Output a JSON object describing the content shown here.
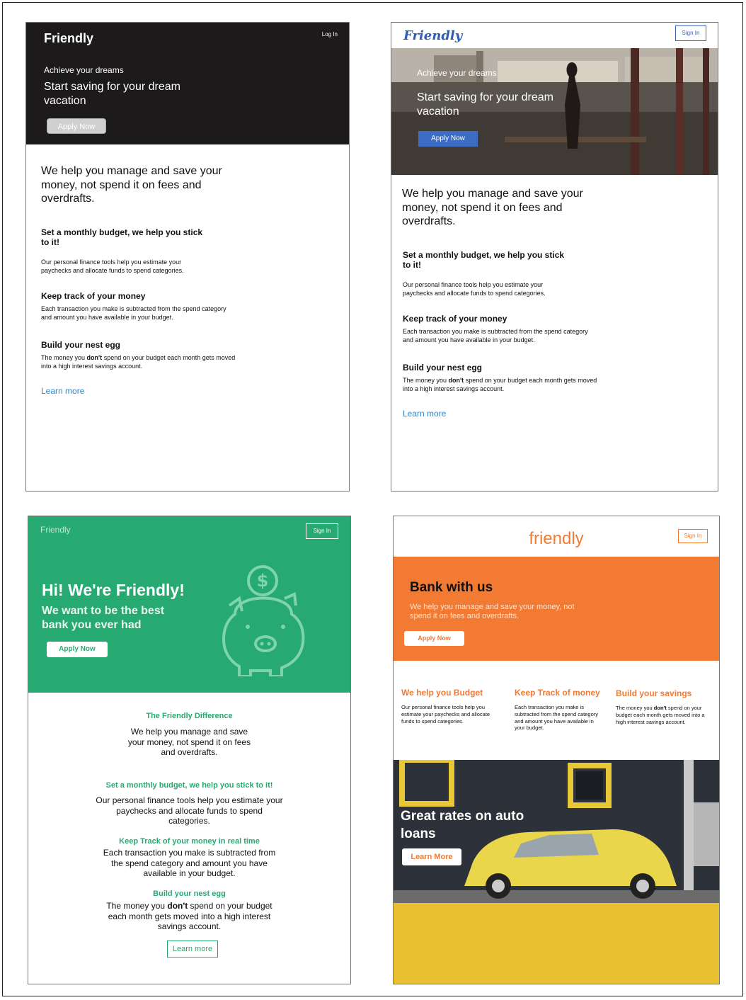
{
  "panel1": {
    "logo": "Friendly",
    "login": "Log In",
    "tagline": "Achieve your dreams",
    "headline": "Start saving for your dream vacation",
    "apply": "Apply Now",
    "intro": "We help you manage and save your money, not spend it on fees and overdrafts.",
    "f1_title": "Set a monthly budget, we help you stick to it!",
    "f1_text": "Our personal finance tools help you estimate your paychecks and allocate funds to spend categories.",
    "f2_title": "Keep track of your money",
    "f2_text": "Each transaction you make is subtracted from the spend category and amount you have available in your budget.",
    "f3_title": "Build your nest egg",
    "f3_pre": "The money you ",
    "f3_bold": "don't",
    "f3_post": " spend on your budget each month gets moved into a high interest savings account.",
    "learn": "Learn more"
  },
  "panel2": {
    "logo": "Friendly",
    "signin": "Sign In",
    "tagline": "Achieve your dreams",
    "headline": "Start saving for your dream vacation",
    "apply": "Apply Now",
    "intro": "We help you manage and save your money, not spend it on fees and overdrafts.",
    "f1_title": "Set a monthly budget, we help you stick to it!",
    "f1_text": "Our personal finance tools help you estimate your paychecks and allocate funds to spend categories.",
    "f2_title": "Keep track of your money",
    "f2_text": "Each transaction you make is subtracted from the spend category and amount you have available in your budget.",
    "f3_title": "Build your nest egg",
    "f3_pre": "The money you ",
    "f3_bold": "don't",
    "f3_post": " spend on your budget each month gets moved into a high interest savings account.",
    "learn": "Learn more"
  },
  "panel3": {
    "logo": "Friendly",
    "signin": "Sign In",
    "headline": "Hi! We're Friendly!",
    "sub": "We want to be the best bank you ever had",
    "apply": "Apply Now",
    "diff_title": "The Friendly Difference",
    "diff_text": "We help you manage and save your money, not spend it on fees and overdrafts.",
    "f1_title": "Set a monthly budget, we help you stick to it!",
    "f1_text": "Our personal finance tools help you estimate your paychecks and allocate funds to spend categories.",
    "f2_title": "Keep Track of your money in real time",
    "f2_text": "Each transaction you make is subtracted from the spend category and amount you have available in your budget.",
    "f3_title": "Build your nest egg",
    "f3_pre": "The money you ",
    "f3_bold": "don't",
    "f3_post": " spend on your budget each month gets moved into a high interest savings account.",
    "learn": "Learn more"
  },
  "panel4": {
    "logo": "friendly",
    "signin": "Sign In",
    "headline": "Bank with us",
    "sub": "We help you manage and save your money, not spend it on fees and overdrafts.",
    "apply": "Apply Now",
    "c1_title": "We help you Budget",
    "c1_text": "Our personal finance tools help you estimate your paychecks and allocate funds to spend categories.",
    "c2_title": "Keep Track of money",
    "c2_text": "Each transaction you make is subtracted from the spend category and amount you have available in your budget.",
    "c3_title": "Build your savings",
    "c3_pre": "The money you ",
    "c3_bold": "don't",
    "c3_post": " spend on your budget each month gets moved into a high interest savings account.",
    "auto_title": "Great rates on auto loans",
    "learn": "Learn More"
  },
  "colors": {
    "panel1_hero": "#1d1a1b",
    "panel2_brand": "#2f5bb0",
    "panel3_green": "#27aa72",
    "panel4_orange": "#f27a33",
    "panel4_yellow": "#e8c032",
    "link_blue": "#2d87c8"
  },
  "icons": [
    "piggy-bank-icon",
    "dollar-coin-icon"
  ]
}
